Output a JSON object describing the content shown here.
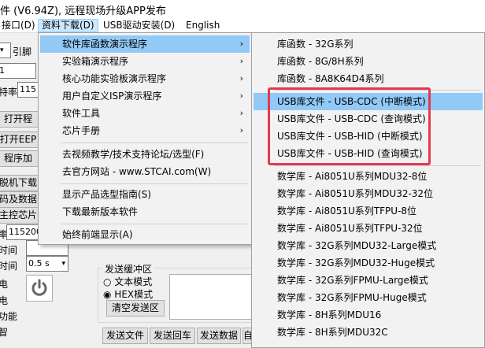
{
  "window": {
    "title": "件 (V6.94Z), 远程现场升级APP发布"
  },
  "menubar": {
    "items": [
      "接口(D)",
      "资料下载(D)",
      "USB驱动安装(D)",
      "English"
    ]
  },
  "background": {
    "labels": {
      "yin_jiao": "引脚",
      "port_suffix": "1",
      "baud": "特率",
      "baud_value": "115",
      "port_value_2": "115200",
      "time1": "时间",
      "time2": "时间",
      "time2_value": "0.5 s",
      "dian1": "电",
      "dian2": "电",
      "func": "功能",
      "zhi": "智"
    },
    "buttons": {
      "open1": "打开程",
      "open2": "打开EEP",
      "prog": "程序加",
      "offline": "脱机下载",
      "code_data": "码及数据",
      "main_chip": "主控芯片"
    },
    "send_panel": {
      "group_label": "发送缓冲区",
      "radio_text": "文本模式",
      "radio_hex": "HEX模式",
      "clear_btn": "清空发送区",
      "send_file": "发送文件",
      "send_return": "发送回车",
      "send_data": "发送数据",
      "auto": "自"
    }
  },
  "download_menu": {
    "items": [
      {
        "label": "软件库函数演示程序",
        "submenu": true,
        "highlight": true
      },
      {
        "label": "实验箱演示程序",
        "submenu": true
      },
      {
        "label": "核心功能实验板演示程序",
        "submenu": true
      },
      {
        "label": "用户自定义ISP演示程序",
        "submenu": true
      },
      {
        "label": "软件工具",
        "submenu": true
      },
      {
        "label": "芯片手册",
        "submenu": true
      },
      {
        "label": "去视频教学/技术支持论坛/选型(F)"
      },
      {
        "label": "去官方网站 - www.STCAI.com(W)"
      },
      {
        "label": "显示产品选型指南(S)"
      },
      {
        "label": "下载最新版本软件"
      },
      {
        "label": "始终前端显示(A)"
      }
    ],
    "submenu_arrow": "›"
  },
  "sub_menu": {
    "items": [
      "库函数 - 32G系列",
      "库函数 - 8G/8H系列",
      "库函数 - 8A8K64D4系列",
      "USB库文件 - USB-CDC (中断模式)",
      "USB库文件 - USB-CDC (查询模式)",
      "USB库文件 - USB-HID (中断模式)",
      "USB库文件 - USB-HID (查询模式)",
      "数学库 - Ai8051U系列MDU32-8位",
      "数学库 - Ai8051U系列MDU32-32位",
      "数学库 - Ai8051U系列TFPU-8位",
      "数学库 - Ai8051U系列TFPU-32位",
      "数学库 - 32G系列MDU32-Large模式",
      "数学库 - 32G系列MDU32-Huge模式",
      "数学库 - 32G系列FPMU-Large模式",
      "数学库 - 32G系列FPMU-Huge模式",
      "数学库 - 8H系列MDU16",
      "数学库 - 8H系列MDU32C"
    ],
    "highlight_index": 3
  },
  "colors": {
    "highlight": "#91c9f7",
    "annotation": "#e53950"
  }
}
